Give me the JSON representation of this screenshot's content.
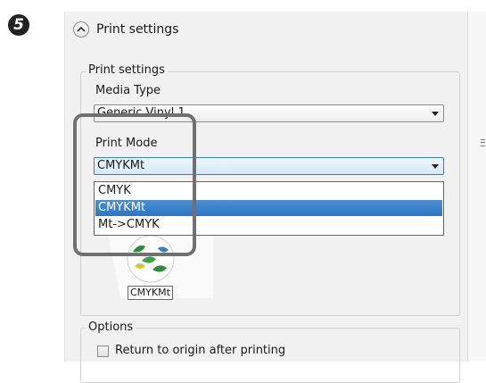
{
  "step_number": "5",
  "section": {
    "title": "Print settings"
  },
  "print_settings_group": {
    "legend": "Print settings",
    "media_type": {
      "label": "Media Type",
      "value": "Generic Vinyl 1"
    },
    "print_mode": {
      "label": "Print Mode",
      "value": "CMYKMt",
      "options": [
        "CMYK",
        "CMYKMt",
        "Mt->CMYK"
      ],
      "selected_index": 1
    },
    "preview_label": "CMYKMt"
  },
  "options_group": {
    "legend": "Options",
    "return_to_origin": {
      "label": "Return to origin after printing",
      "checked": false
    }
  }
}
